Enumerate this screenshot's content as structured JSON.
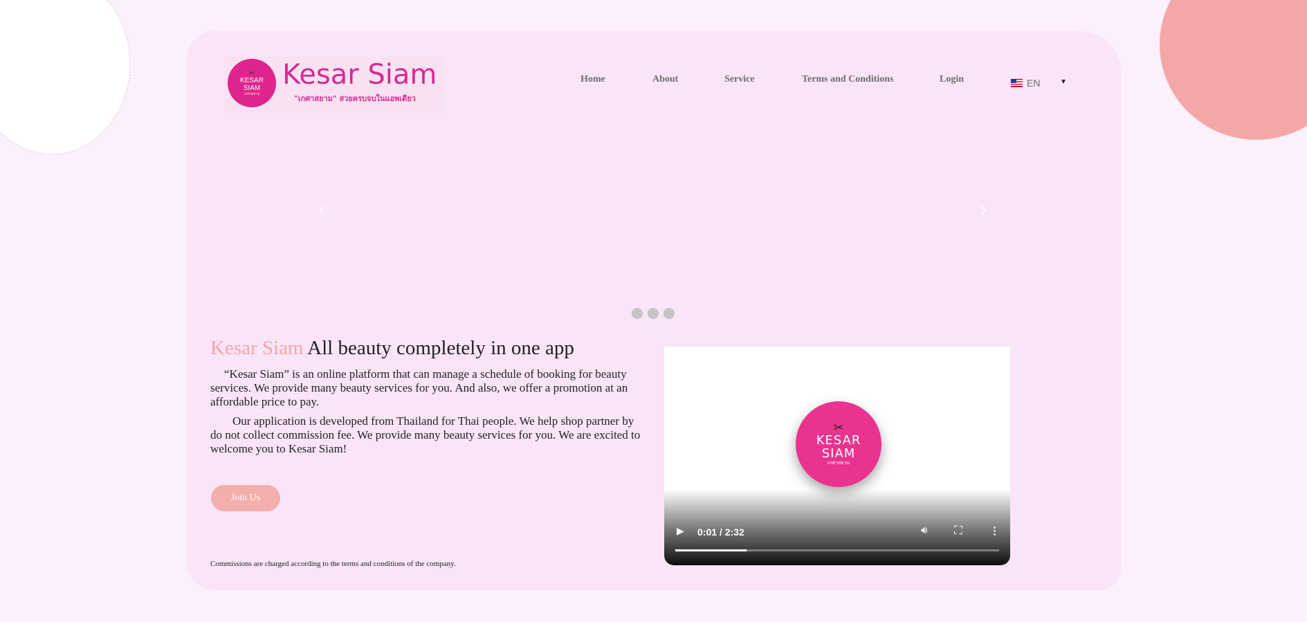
{
  "brand": {
    "name": "Kesar Siam",
    "tagline": "\"เกศาสยาม\" สวยครบจบในแอพเดียว",
    "badge_line1": "KESAR",
    "badge_line2": "SIAM",
    "badge_sub": "เกศาสยาม"
  },
  "nav": {
    "home": "Home",
    "about": "About",
    "service": "Service",
    "terms": "Terms and Conditions",
    "login": "Login"
  },
  "language": {
    "selected": "EN"
  },
  "carousel": {
    "prev": "‹",
    "next": "›",
    "slide_count": 3
  },
  "content": {
    "headline_brand": "Kesar Siam",
    "headline_rest": " All beauty completely in one app",
    "para1": "“Kesar Siam” is an online platform that can manage a schedule of booking for beauty services. We provide many beauty services for you. And also, we offer a promotion at an affordable price to pay.",
    "para2": "Our application is developed from Thailand for Thai people. We help shop partner by do not collect commission fee. We provide many beauty services for you. We are excited to welcome you to Kesar Siam!",
    "join_button": "Join Us",
    "footnote": "Commissions are charged according to the terms and conditions of the company."
  },
  "video": {
    "logo_line1": "KESAR",
    "logo_line2": "SIAM",
    "logo_sub": "เกศาสยาม",
    "time": "0:01 / 2:32",
    "progress": 0.22
  },
  "colors": {
    "page_bg": "#fbf0fc",
    "card_bg": "#f9e4f8",
    "brand_magenta": "#d62a94",
    "accent_peach": "#f4aeab"
  },
  "icons": {
    "play": "play-icon",
    "volume": "volume-icon",
    "fullscreen": "fullscreen-icon",
    "menu": "more-vert-icon",
    "caret": "caret-down-icon",
    "flag": "us-flag-icon"
  }
}
